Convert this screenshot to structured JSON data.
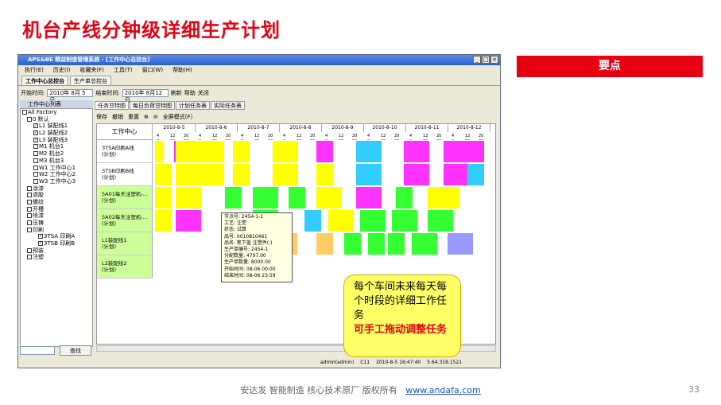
{
  "slide": {
    "title": "机台产线分钟级详细生产计划",
    "key_points": "要点",
    "page_no": "33"
  },
  "footer": {
    "text": "安达发  智能制造 核心技术原厂   版权所有",
    "link": "www.andafa.com"
  },
  "callout": {
    "line1": "每个车间未来每天每个时段的详细工作任务",
    "line2": "可手工拖动调整任务"
  },
  "app": {
    "title": "APS&BE 精益制造管理系统 - [工作中心总控台]",
    "menu": [
      "执行(E)",
      "历史(I)",
      "收藏夹(F)",
      "工具(T)",
      "窗口(W)",
      "帮助(H)"
    ],
    "tabs": [
      "工作中心总控台",
      "生产单总控台"
    ],
    "filter": {
      "start_label": "开始时间:",
      "start_value": "2010年 8月 5日",
      "end_label": "结束时间:",
      "end_value": "2010年 8月12日",
      "refresh": "刷新",
      "help": "帮助",
      "close": "关闭"
    },
    "sidebar": {
      "header": "工作中心列表",
      "items": [
        "All Factory",
        "0 默认",
        "L1 装配线1",
        "L2 装配线2",
        "L3 装配线3",
        "M1 机台1",
        "M2 机台2",
        "M3 机台3",
        "W1 工作中心1",
        "W2 工作中心2",
        "W3 工作中心3",
        "涂漆",
        "退胶",
        "螺纹",
        "开槽",
        "喷漆",
        "压铸",
        "印刷",
        "3TSA 印刷A",
        "3TSB 印刷B",
        "预装",
        "注塑"
      ],
      "find_button": "查找"
    },
    "subtabs": [
      "任务甘特图",
      "每日负荷甘特图",
      "计划任务表",
      "实际任务表"
    ],
    "toolbar": [
      "保存",
      "撤销",
      "重置",
      "全屏模式(F)"
    ],
    "gantt": {
      "wc_header": "工作中心",
      "dates": [
        "2010-8-5",
        "2010-8-6",
        "2010-8-7",
        "2010-8-8",
        "2010-8-9",
        "2010-8-10",
        "2010-8-11",
        "2010-8-12"
      ],
      "hours": [
        "4",
        "12",
        "20"
      ],
      "rows": [
        {
          "name": "3TSA印刷A线",
          "sub": "(计划)"
        },
        {
          "name": "3TSB印刷B线",
          "sub": "(计划)"
        },
        {
          "name": "5A01每天注塑机-...",
          "sub": "(计划)"
        },
        {
          "name": "5A02每天注塑机-...",
          "sub": "(计划)"
        },
        {
          "name": "L1装配线1",
          "sub": "(计划)"
        },
        {
          "name": "L2装配线2",
          "sub": "(计划)"
        }
      ]
    },
    "tooltip": [
      "节点号: 2454-1-1",
      "工艺: 注塑",
      "状态: 试算",
      "品号: 0010810461",
      "品名: 笔下盖    注塑件(.)",
      "生产单编号: 2454-1",
      "分配数量: 4797.00",
      "生产单数量: 8000.00",
      "开始时间: 08-06 00:00",
      "结束时间: 08-06 23:59"
    ],
    "status": [
      "admin(admin)",
      "C11",
      "2010-8-5 16:47:40",
      "5.64.318.1521"
    ]
  },
  "colors": {
    "accent": "#e60012",
    "callout": "#ffff66",
    "gantt_yellow": "#ffff00",
    "gantt_magenta": "#ff33ff",
    "gantt_cyan": "#33ccff",
    "gantt_green": "#33ff33",
    "gantt_orange": "#ffcc66",
    "gantt_violet": "#9999ff",
    "row_green": "#ccff99"
  }
}
